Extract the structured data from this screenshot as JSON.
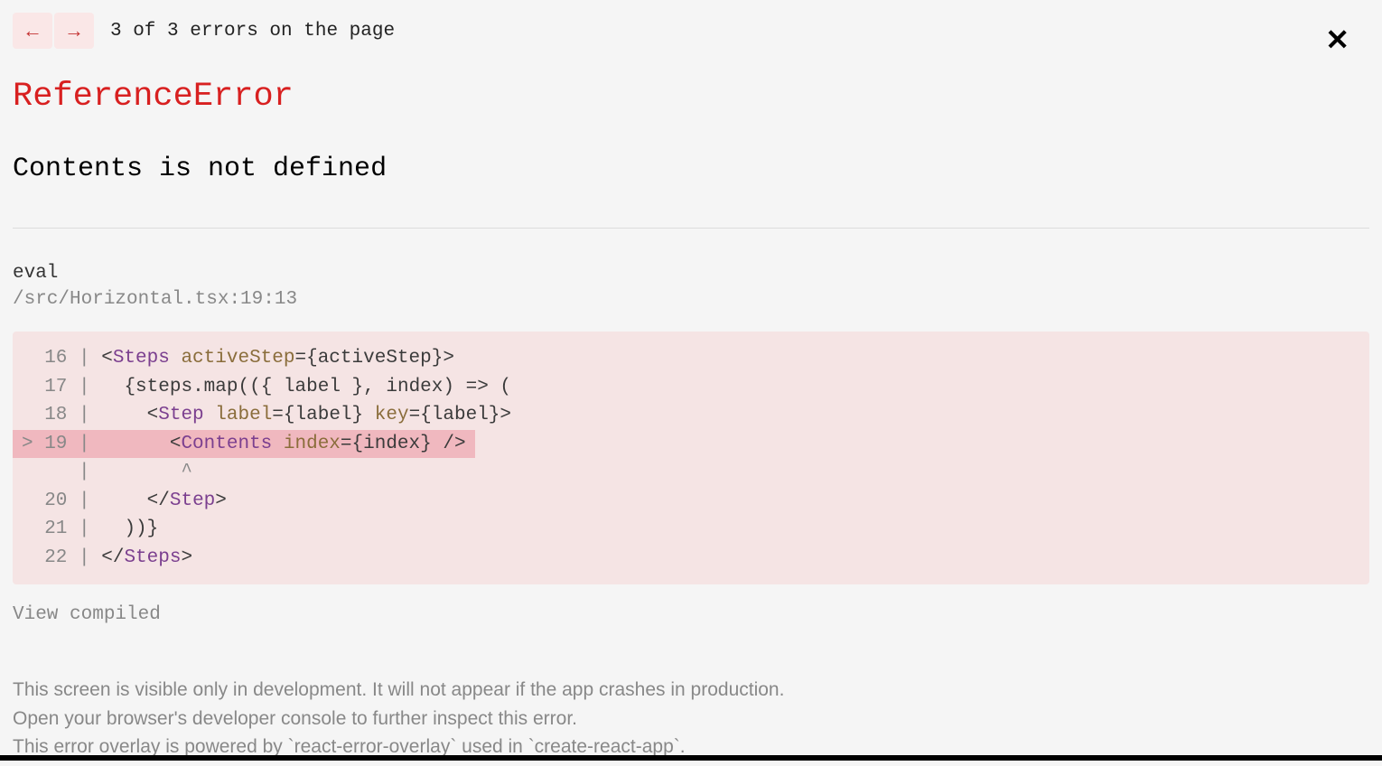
{
  "nav": {
    "prev_arrow": "←",
    "next_arrow": "→",
    "error_count": "3 of 3 errors on the page",
    "close_symbol": "✕"
  },
  "error": {
    "type": "ReferenceError",
    "message": "Contents is not defined"
  },
  "frame": {
    "name": "eval",
    "location": "/src/Horizontal.tsx:19:13"
  },
  "code": {
    "lines": [
      {
        "gutter": "  16 | ",
        "highlighted": false
      },
      {
        "gutter": "  17 | ",
        "highlighted": false
      },
      {
        "gutter": "  18 | ",
        "highlighted": false
      },
      {
        "gutter": "> 19 | ",
        "highlighted": true
      },
      {
        "gutter": "     | ",
        "highlighted": false,
        "caret": "       ^"
      },
      {
        "gutter": "  20 | ",
        "highlighted": false
      },
      {
        "gutter": "  21 | ",
        "highlighted": false
      },
      {
        "gutter": "  22 | ",
        "highlighted": false
      }
    ],
    "tokens": {
      "l16": {
        "open": "<",
        "tag": "Steps",
        "sp": " ",
        "attr": "activeStep",
        "eq": "=",
        "lb": "{",
        "id": "activeStep",
        "rb": "}",
        "close": ">"
      },
      "l17": {
        "indent": "  ",
        "lb": "{",
        "id1": "steps",
        "dot": ".",
        "id2": "map",
        "lp": "((",
        "lb2": "{ ",
        "id3": "label",
        "rb2": " }",
        "c": ", ",
        "id4": "index",
        "rp": ") => ("
      },
      "l18": {
        "indent": "    ",
        "open": "<",
        "tag": "Step",
        "sp": " ",
        "attr1": "label",
        "eq": "=",
        "lb": "{",
        "id1": "label",
        "rb": "}",
        "sp2": " ",
        "attr2": "key",
        "eq2": "=",
        "lb2": "{",
        "id2": "label",
        "rb2": "}",
        "close": ">"
      },
      "l19": {
        "indent": "      ",
        "open": "<",
        "tag": "Contents",
        "sp": " ",
        "attr": "index",
        "eq": "=",
        "lb": "{",
        "id": "index",
        "rb": "}",
        "sp2": " ",
        "close": "/>"
      },
      "l20": {
        "indent": "    ",
        "open": "</",
        "tag": "Step",
        "close": ">"
      },
      "l21": {
        "indent": "  ",
        "text": "))}"
      },
      "l22": {
        "open": "</",
        "tag": "Steps",
        "close": ">"
      }
    }
  },
  "view_compiled": "View compiled",
  "footer": {
    "line1": "This screen is visible only in development. It will not appear if the app crashes in production.",
    "line2": "Open your browser's developer console to further inspect this error.",
    "line3": "This error overlay is powered by `react-error-overlay` used in `create-react-app`."
  }
}
